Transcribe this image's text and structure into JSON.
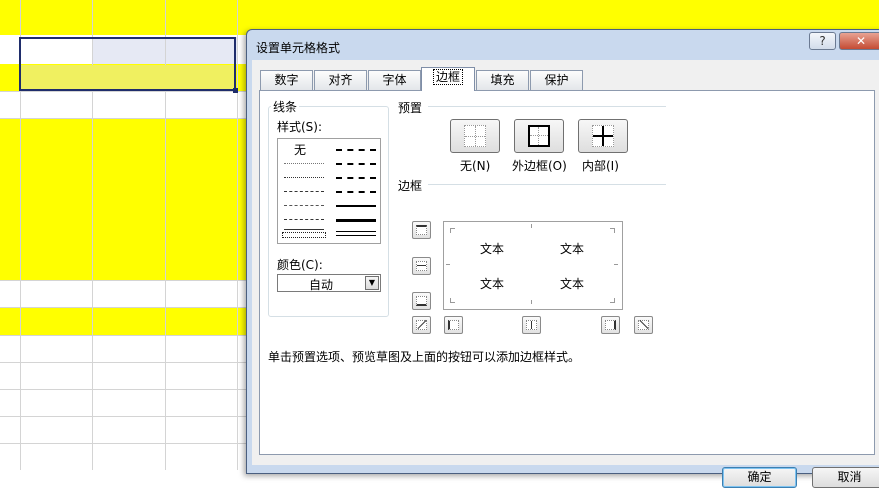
{
  "dialog": {
    "title": "设置单元格格式",
    "help_label": "?",
    "close_label": "✕"
  },
  "tabs": [
    {
      "label": "数字"
    },
    {
      "label": "对齐"
    },
    {
      "label": "字体"
    },
    {
      "label": "边框",
      "active": true
    },
    {
      "label": "填充"
    },
    {
      "label": "保护"
    }
  ],
  "line_group": {
    "title": "线条",
    "style_label": "样式(S):",
    "none_label": "无",
    "color_label": "颜色(C):",
    "color_value": "自动"
  },
  "presets": {
    "title": "预置",
    "items": [
      {
        "label": "无(N)"
      },
      {
        "label": "外边框(O)"
      },
      {
        "label": "内部(I)"
      }
    ]
  },
  "border": {
    "title": "边框",
    "preview_texts": [
      "文本",
      "文本",
      "文本",
      "文本"
    ]
  },
  "hint": "单击预置选项、预览草图及上面的按钮可以添加边框样式。",
  "buttons": {
    "ok": "确定",
    "cancel": "取消"
  },
  "colors": {
    "highlight": "#ffff00",
    "selection_border": "#1f2d6b"
  }
}
